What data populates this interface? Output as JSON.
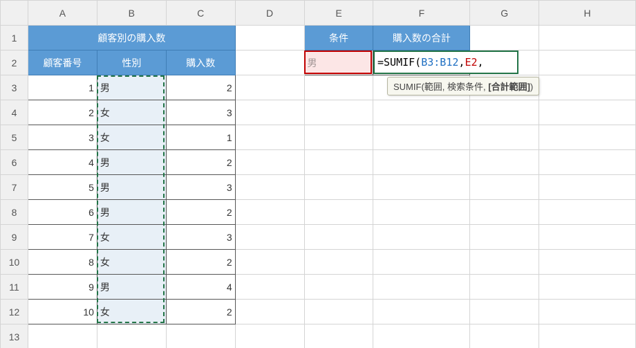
{
  "columns": [
    "A",
    "B",
    "C",
    "D",
    "E",
    "F",
    "G",
    "H"
  ],
  "rowCount": 13,
  "colWidths": {
    "A": 100,
    "B": 100,
    "C": 100,
    "D": 100,
    "E": 100,
    "F": 140,
    "G": 100,
    "H": 100
  },
  "table1": {
    "title": "顧客別の購入数",
    "headers": {
      "a": "顧客番号",
      "b": "性別",
      "c": "購入数"
    },
    "rows": [
      {
        "id": 1,
        "sex": "男",
        "qty": 2
      },
      {
        "id": 2,
        "sex": "女",
        "qty": 3
      },
      {
        "id": 3,
        "sex": "女",
        "qty": 1
      },
      {
        "id": 4,
        "sex": "男",
        "qty": 2
      },
      {
        "id": 5,
        "sex": "男",
        "qty": 3
      },
      {
        "id": 6,
        "sex": "男",
        "qty": 2
      },
      {
        "id": 7,
        "sex": "女",
        "qty": 3
      },
      {
        "id": 8,
        "sex": "女",
        "qty": 2
      },
      {
        "id": 9,
        "sex": "男",
        "qty": 4
      },
      {
        "id": 10,
        "sex": "女",
        "qty": 2
      }
    ]
  },
  "table2": {
    "headers": {
      "e": "条件",
      "f": "購入数の合計"
    },
    "e2": "男"
  },
  "formula": {
    "prefix": "=SUMIF(",
    "ref1": "B3:B12",
    "sep1": ",",
    "ref2": "E2",
    "suffix": ","
  },
  "tooltip": {
    "fn": "SUMIF",
    "args_pre": "(範囲, 検索条件, ",
    "args_bold": "[合計範囲]",
    "args_post": ")"
  }
}
